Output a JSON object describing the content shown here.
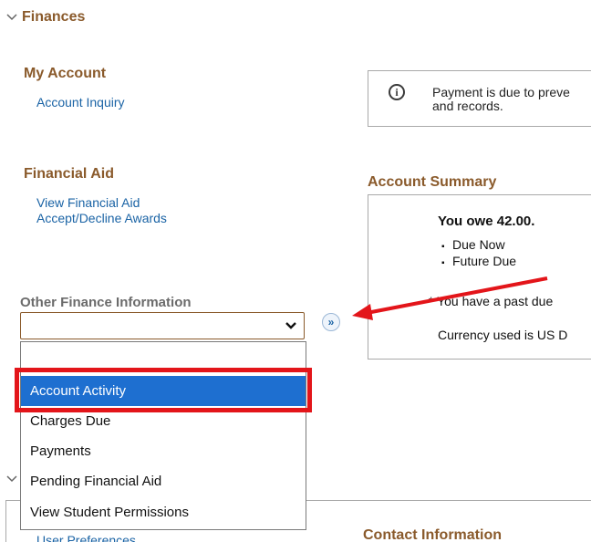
{
  "section": {
    "title": "Finances",
    "chevron": "chevron-down-icon"
  },
  "my_account": {
    "title": "My Account",
    "links": [
      "Account Inquiry"
    ]
  },
  "financial_aid": {
    "title": "Financial Aid",
    "links": [
      "View Financial Aid",
      "Accept/Decline Awards"
    ]
  },
  "other_finance": {
    "label": "Other Finance Information",
    "selected_value": "",
    "go_icon": "double-chevron-right-icon",
    "options": [
      "",
      "Account Activity",
      "Charges Due",
      "Payments",
      "Pending Financial Aid",
      "View Student Permissions"
    ],
    "highlighted_option": "Account Activity"
  },
  "notice": {
    "icon": "info-icon",
    "line1": "Payment is due to preve",
    "line2": "and records."
  },
  "account_summary": {
    "title": "Account Summary",
    "owe": "You owe 42.00.",
    "bullets": [
      "Due Now",
      "Future Due"
    ],
    "past_due": "* You have a past due",
    "currency": "Currency used is US D"
  },
  "bottom": {
    "user_preferences": "User Preferences",
    "contact_title": "Contact Information"
  },
  "annotations": {
    "highlight_color": "#e3151a",
    "selected_bg": "#1e6fd0"
  }
}
